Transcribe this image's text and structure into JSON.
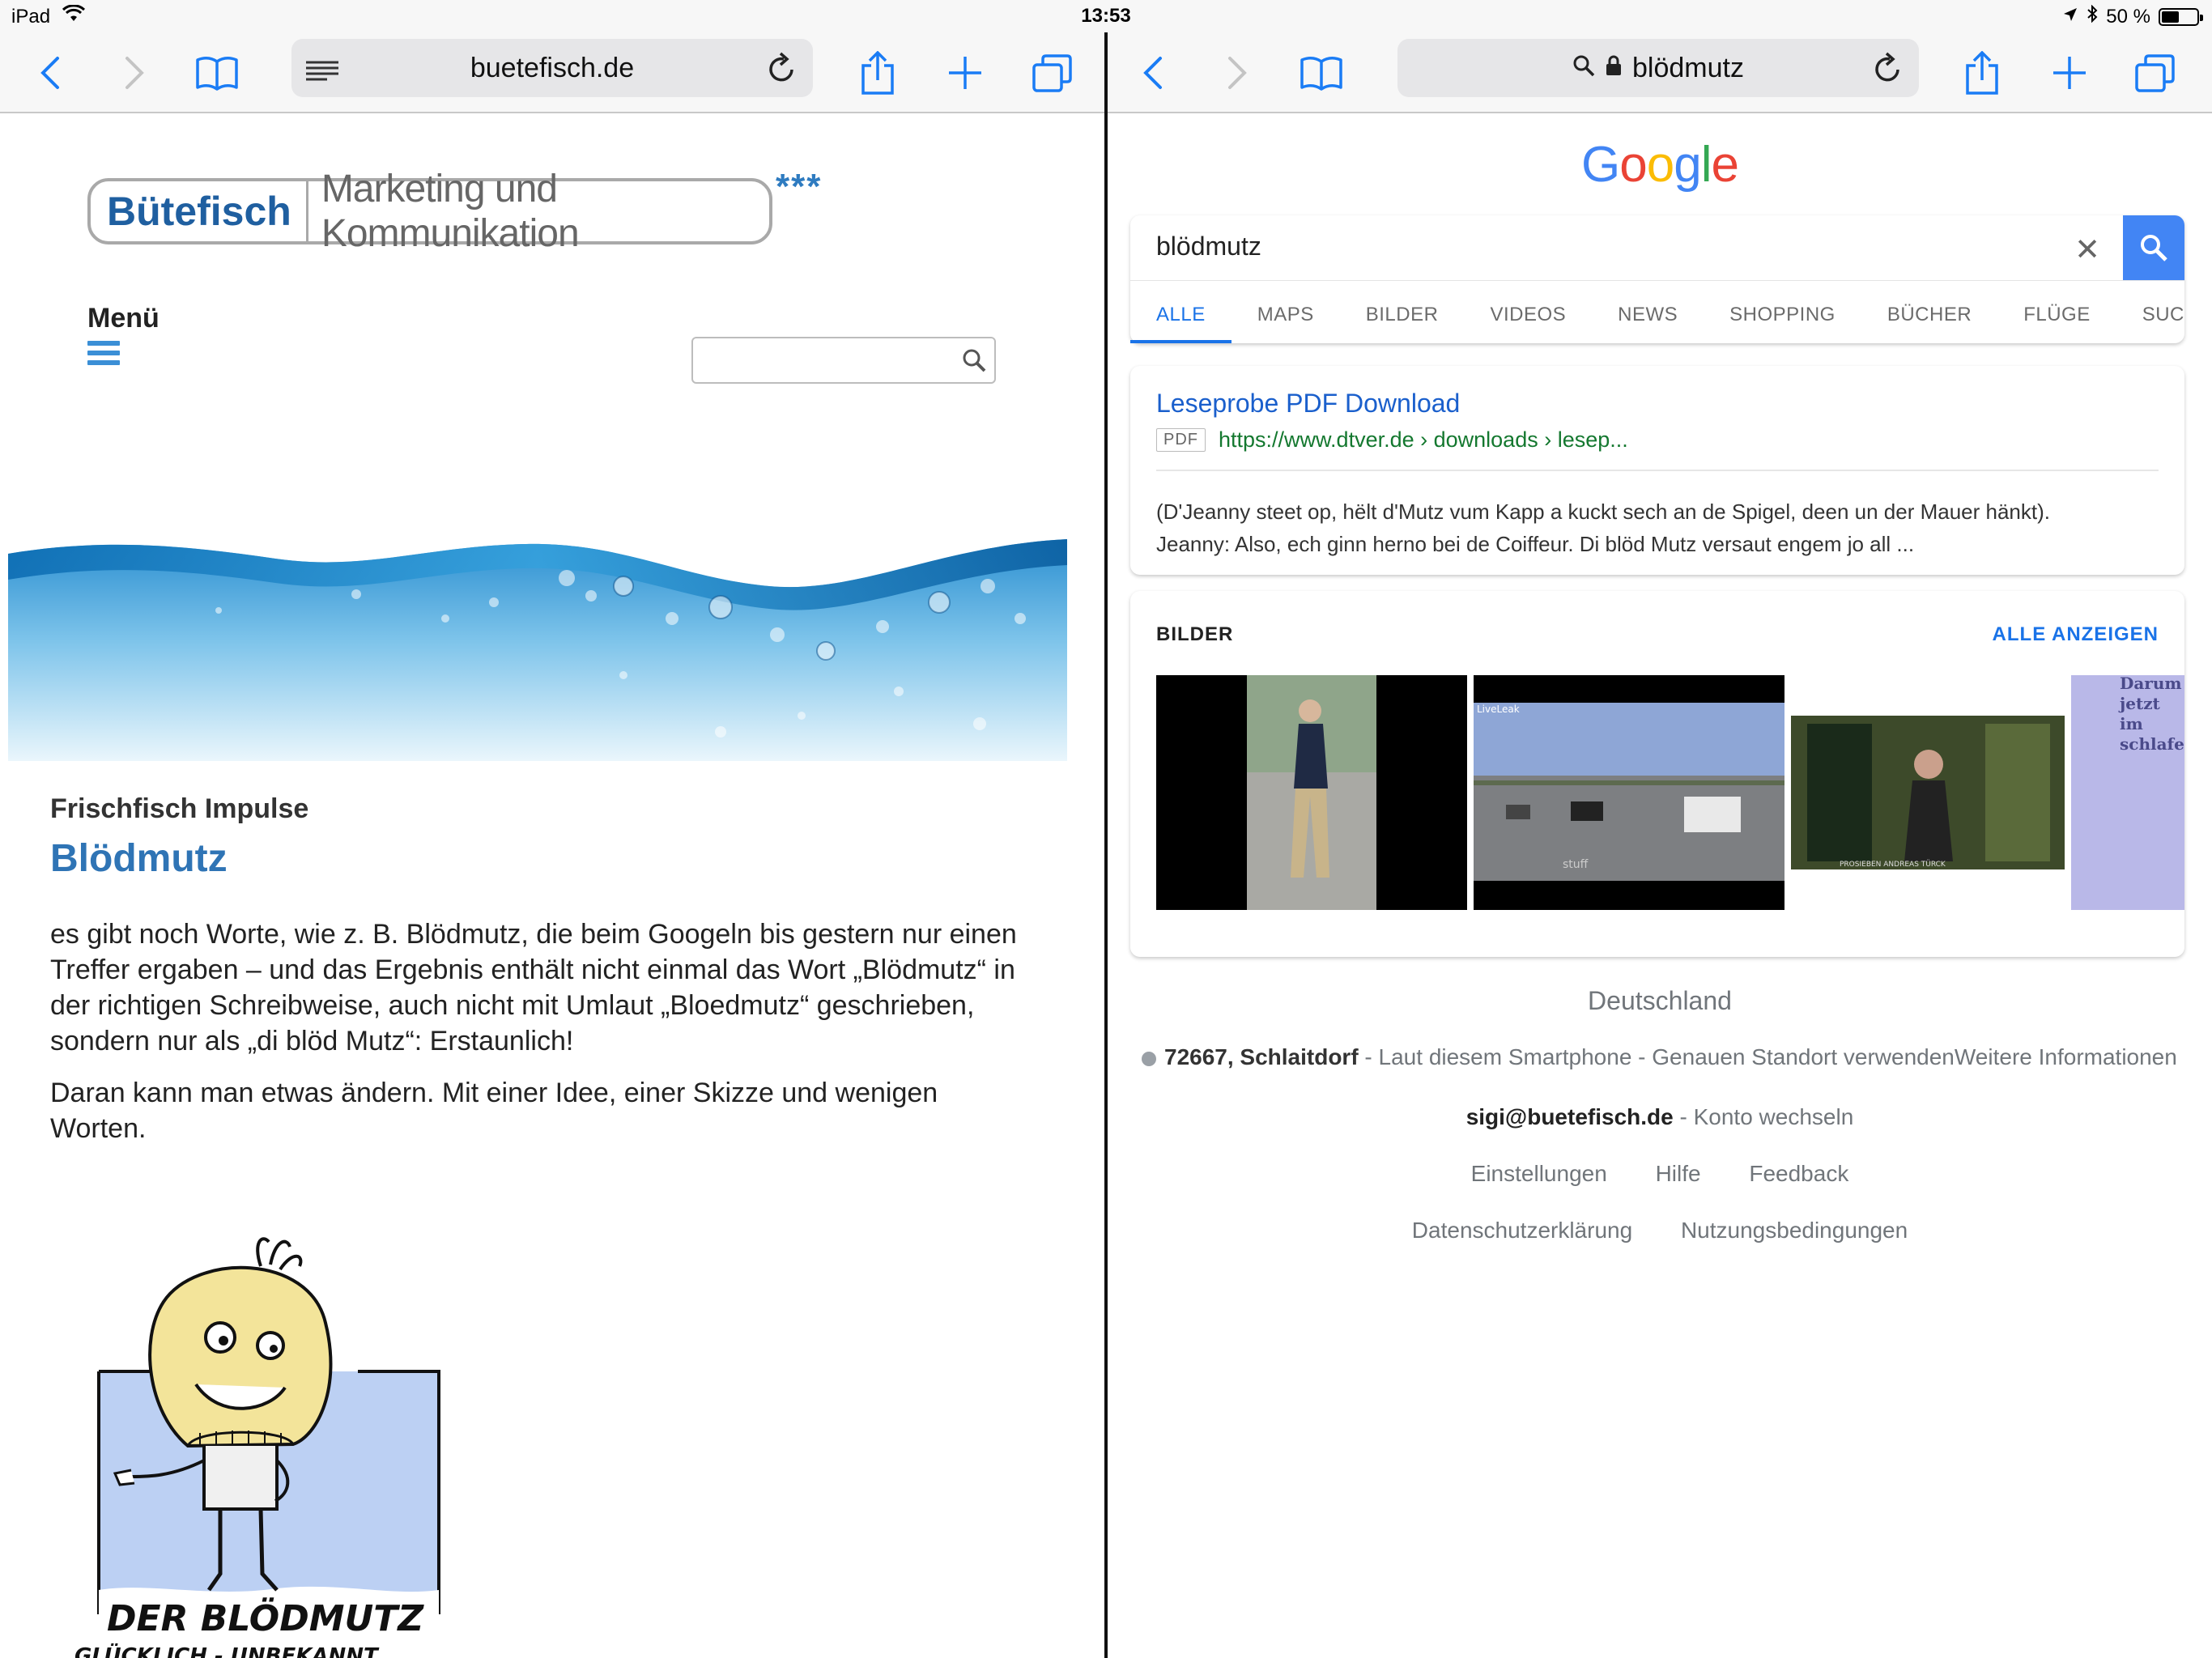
{
  "status": {
    "device": "iPad",
    "time": "13:53",
    "battery": "50 %",
    "battery_level": 0.5
  },
  "left": {
    "url": "buetefisch.de",
    "site": {
      "logo_brand": "Bütefisch",
      "logo_tagline": "Marketing und Kommunikation",
      "logo_stars": "***",
      "menu_label": "Menü",
      "search_placeholder": "",
      "kicker": "Frischfisch Impulse",
      "headline": "Blödmutz",
      "paragraph1": "es gibt noch Worte, wie z. B.  Blödmutz, die beim Googeln bis gestern nur einen Treffer ergaben – und das Ergebnis enthält nicht einmal das Wort „Blödmutz“ in der richtigen Schreibweise, auch nicht mit Umlaut „Bloedmutz“ geschrieben, sondern nur als „di blöd Mutz“: Erstaunlich!",
      "paragraph2": "Daran kann man etwas ändern. Mit einer Idee, einer Skizze und wenigen Worten.",
      "sketch_title": "DER BLÖDMUTZ",
      "sketch_subtitle": "GLÜCKLICH - UNBEKANNT"
    }
  },
  "right": {
    "url": "blödmutz",
    "google": {
      "logo": "Google",
      "query": "blödmutz",
      "tabs": [
        "ALLE",
        "MAPS",
        "BILDER",
        "VIDEOS",
        "NEWS",
        "SHOPPING",
        "BÜCHER",
        "FLÜGE",
        "SUCH"
      ],
      "result": {
        "title": "Leseprobe PDF Download",
        "badge": "PDF",
        "url": "https://www.dtver.de › downloads › lesep...",
        "snippet_line1": "(D'Jeanny steet op, hëlt d'Mutz vum Kapp a kuckt sech an de Spigel, deen un der Mauer hänkt).",
        "snippet_line2": "Jeanny: Also, ech ginn herno bei de Coiffeur. Di blöd Mutz versaut engem jo all ..."
      },
      "images": {
        "header": "BILDER",
        "more": "ALLE ANZEIGEN",
        "thumb2_caption": "LiveLeak",
        "thumb2_sub": "stuff",
        "thumb3_caption": "PROSIEBEN   ANDREAS TÜRCK",
        "thumb4_text": "Darum jetzt im schlafe"
      },
      "footer": {
        "country": "Deutschland",
        "location_place": "72667, Schlaitdorf",
        "location_rest": " - Laut diesem Smartphone - Genauen Standort verwendenWeitere Informationen",
        "account": "sigi@buetefisch.de",
        "account_switch": " - Konto wechseln",
        "settings": "Einstellungen",
        "help": "Hilfe",
        "feedback": "Feedback",
        "privacy": "Datenschutzerklärung",
        "terms": "Nutzungsbedingungen"
      }
    }
  },
  "colors": {
    "ios_blue": "#1a7cf5",
    "google_blue": "#4285f4",
    "site_blue": "#2f74b5"
  }
}
